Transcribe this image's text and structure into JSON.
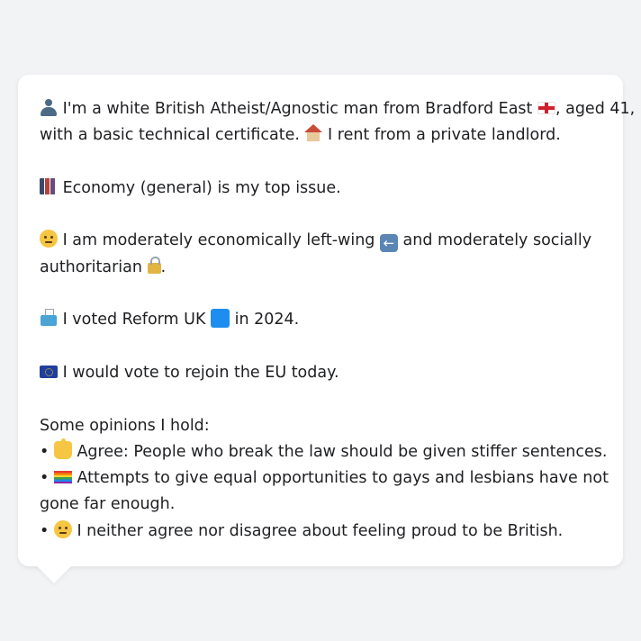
{
  "profile": {
    "line1_a": " I'm a white British Atheist/Agnostic man from Bradford East ",
    "line1_b": ", aged 41,",
    "line2_a": "with a basic technical certificate. ",
    "line2_b": " I rent from a private landlord.",
    "issue": " Economy (general) is my top issue.",
    "ideology_a": " I am moderately economically left-wing ",
    "ideology_b": " and moderately socially",
    "ideology_c": "authoritarian ",
    "ideology_d": ".",
    "vote_a": " I voted Reform UK ",
    "vote_b": " in 2024.",
    "eu": " I would vote to rejoin the EU today.",
    "opinions_heading": "Some opinions I hold:",
    "bullet": "• ",
    "opinion1": " Agree: People who break the law should be given stiffer sentences.",
    "opinion2_a": " Attempts to give equal opportunities to gays and lesbians have not",
    "opinion2_b": "gone far enough.",
    "opinion3": " I neither agree nor disagree about feeling proud to be British."
  },
  "colors": {
    "page_background": "#f2f3f5",
    "bubble_background": "#ffffff",
    "text": "#1e1f22",
    "reform_square": "#1d8ef0"
  },
  "icons": {
    "person": "bust-in-silhouette-icon",
    "england_flag": "england-flag-icon",
    "house": "house-icon",
    "economy": "ledger-icon",
    "thinking": "thinking-face-icon",
    "left_arrow": "left-arrow-icon",
    "lock": "locked-icon",
    "ballot": "ballot-box-icon",
    "blue_square": "blue-square-icon",
    "eu_flag": "eu-flag-icon",
    "thumbs_up": "thumbs-up-icon",
    "rainbow_flag": "rainbow-flag-icon"
  }
}
